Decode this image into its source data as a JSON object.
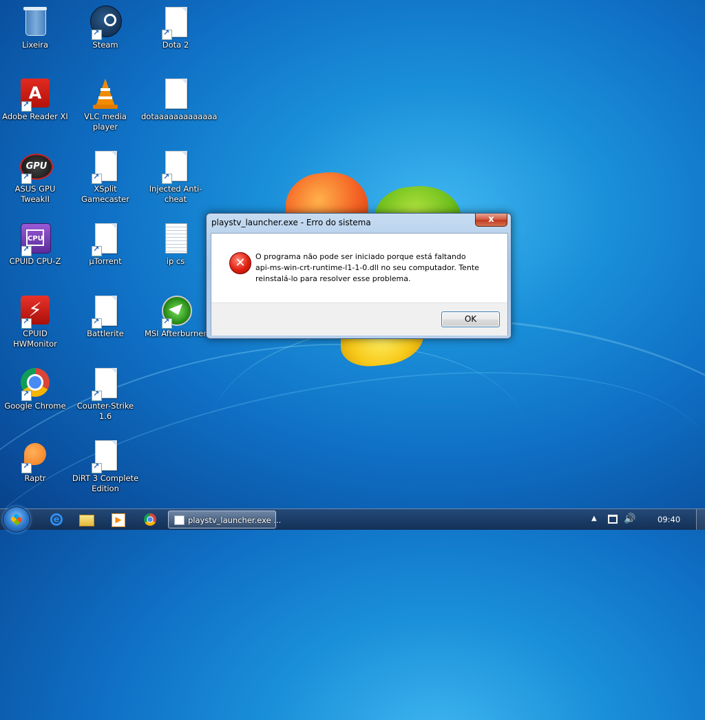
{
  "desktop": {
    "icons": [
      {
        "id": "lixeira",
        "label": "Lixeira"
      },
      {
        "id": "steam",
        "label": "Steam"
      },
      {
        "id": "dota2",
        "label": "Dota 2"
      },
      {
        "id": "adobe",
        "label": "Adobe Reader XI"
      },
      {
        "id": "vlc",
        "label": "VLC media player"
      },
      {
        "id": "dotaa",
        "label": "dotaaaaaaaaaaaaa"
      },
      {
        "id": "asus",
        "label": "ASUS GPU TweakII"
      },
      {
        "id": "xsplit",
        "label": "XSplit Gamecaster"
      },
      {
        "id": "injected",
        "label": "Injected Anti-cheat"
      },
      {
        "id": "cpuz",
        "label": "CPUID CPU-Z"
      },
      {
        "id": "utorrent",
        "label": "µTorrent"
      },
      {
        "id": "ipcs",
        "label": "ip cs"
      },
      {
        "id": "hwmonitor",
        "label": "CPUID HWMonitor"
      },
      {
        "id": "battlerite",
        "label": "Battlerite"
      },
      {
        "id": "msi",
        "label": "MSI Afterburner"
      },
      {
        "id": "chrome",
        "label": "Google Chrome"
      },
      {
        "id": "cs16",
        "label": "Counter-Strike 1.6"
      },
      {
        "id": "raptr",
        "label": "Raptr"
      },
      {
        "id": "dirt3",
        "label": "DiRT 3 Complete Edition"
      }
    ]
  },
  "dialog": {
    "title": "playstv_launcher.exe - Erro do sistema",
    "close_symbol": "x",
    "message_line1": "O programa não pode ser iniciado porque está faltando",
    "message_line2": "api-ms-win-crt-runtime-l1-1-0.dll no seu computador. Tente",
    "message_line3": "reinstalá-lo para resolver esse problema.",
    "ok_label": "OK"
  },
  "taskbar": {
    "task_label": "playstv_launcher.exe ...",
    "clock": "09:40",
    "tray_arrow": "▲"
  }
}
